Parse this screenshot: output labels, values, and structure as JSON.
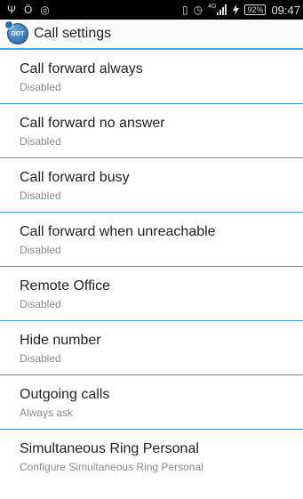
{
  "status_bar": {
    "left_icons": [
      {
        "name": "usb-icon",
        "glyph": "Ψ"
      },
      {
        "name": "debug-icon",
        "glyph": "Ö"
      },
      {
        "name": "app-notification-icon",
        "glyph": "◎"
      }
    ],
    "right_icons": [
      {
        "name": "vibrate-icon",
        "glyph": "▯"
      },
      {
        "name": "alarm-icon",
        "glyph": "◷"
      }
    ],
    "network": "4G",
    "battery": "92%",
    "time": "09:47"
  },
  "action_bar": {
    "icon_label": "DOT",
    "title": "Call settings"
  },
  "settings": [
    {
      "title": "Call forward always",
      "subtitle": "Disabled"
    },
    {
      "title": "Call forward no answer",
      "subtitle": "Disabled"
    },
    {
      "title": "Call forward busy",
      "subtitle": "Disabled"
    },
    {
      "title": "Call forward when unreachable",
      "subtitle": "Disabled"
    },
    {
      "title": "Remote Office",
      "subtitle": "Disabled"
    },
    {
      "title": "Hide number",
      "subtitle": "Disabled"
    },
    {
      "title": "Outgoing calls",
      "subtitle": "Always ask"
    },
    {
      "title": "Simultaneous Ring Personal",
      "subtitle": "Configure Simultaneous Ring Personal"
    }
  ],
  "colors": {
    "accent": "#33b5e5",
    "divider": "#4a9bd6",
    "status_bar": "#000000"
  }
}
